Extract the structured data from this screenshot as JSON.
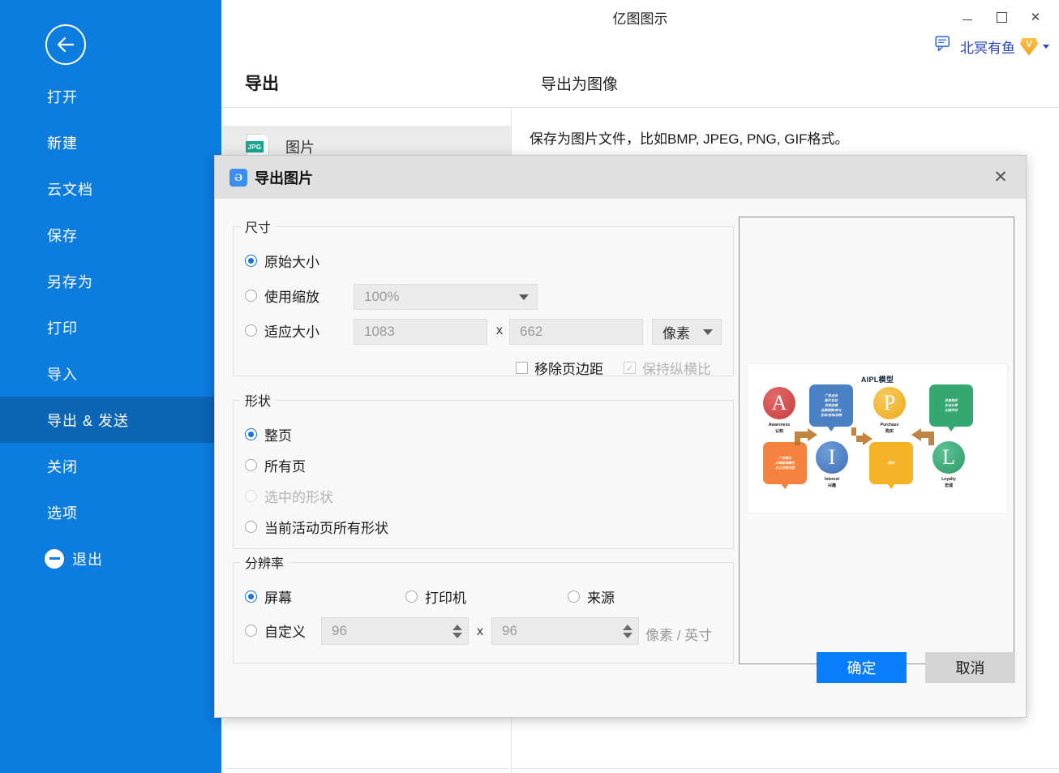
{
  "app": {
    "title": "亿图图示",
    "window_controls": {
      "minimize": "–",
      "maximize": "□",
      "close": "×"
    },
    "account": {
      "name": "北冥有鱼",
      "badge": "V"
    }
  },
  "backstage": {
    "back_icon": "back-arrow-icon",
    "items": [
      {
        "label": "打开",
        "active": false
      },
      {
        "label": "新建",
        "active": false
      },
      {
        "label": "云文档",
        "active": false
      },
      {
        "label": "保存",
        "active": false
      },
      {
        "label": "另存为",
        "active": false
      },
      {
        "label": "打印",
        "active": false
      },
      {
        "label": "导入",
        "active": false
      },
      {
        "label": "导出 & 发送",
        "active": true
      },
      {
        "label": "关闭",
        "active": false
      },
      {
        "label": "选项",
        "active": false
      }
    ],
    "exit": {
      "label": "退出"
    }
  },
  "stage": {
    "heading": "导出",
    "subheading": "导出为图像",
    "file_item": {
      "icon_label": "JPG",
      "label": "图片"
    },
    "description": "保存为图片文件，比如BMP, JPEG, PNG, GIF格式。"
  },
  "dialog": {
    "logo_glyph": "Ə",
    "title": "导出图片",
    "close_label": "✕",
    "size": {
      "legend": "尺寸",
      "original": {
        "label": "原始大小",
        "selected": true
      },
      "scale": {
        "label": "使用缩放",
        "selected": false,
        "value": "100%"
      },
      "fit": {
        "label": "适应大小",
        "selected": false,
        "width": "1083",
        "height": "662",
        "separator": "x",
        "unit": "像素"
      },
      "remove_margin": {
        "label": "移除页边距",
        "checked": false,
        "disabled": false
      },
      "keep_ratio": {
        "label": "保持纵横比",
        "checked": true,
        "disabled": true,
        "tick": "✓"
      }
    },
    "shape": {
      "legend": "形状",
      "options": [
        {
          "label": "整页",
          "selected": true,
          "disabled": false
        },
        {
          "label": "所有页",
          "selected": false,
          "disabled": false
        },
        {
          "label": "选中的形状",
          "selected": false,
          "disabled": true
        },
        {
          "label": "当前活动页所有形状",
          "selected": false,
          "disabled": false
        }
      ]
    },
    "resolution": {
      "legend": "分辨率",
      "options": [
        {
          "label": "屏幕",
          "selected": true
        },
        {
          "label": "打印机",
          "selected": false
        },
        {
          "label": "来源",
          "selected": false
        }
      ],
      "custom": {
        "label": "自定义",
        "selected": false,
        "x": "96",
        "y": "96",
        "separator": "x",
        "unit": "像素 / 英寸"
      }
    },
    "buttons": {
      "ok": "确定",
      "cancel": "取消"
    },
    "preview": {
      "diagram_title": "AIPL模型",
      "nodes": [
        {
          "letter": "A",
          "en": "Awareness",
          "cn": "认知",
          "color": "#d94a4a"
        },
        {
          "letter": "I",
          "en": "Interest",
          "cn": "兴趣",
          "color": "#4a80c4"
        },
        {
          "letter": "P",
          "en": "Purchase",
          "cn": "购买",
          "color": "#f0b429"
        },
        {
          "letter": "L",
          "en": "Loyalty",
          "cn": "忠诚",
          "color": "#34a870"
        }
      ],
      "bubbles": [
        {
          "text": "广告点击\n影片互动\n浏览店铺\n品牌搜索/参与\n互动/咨询/加购",
          "color": "#4a80c4"
        },
        {
          "text": "广告曝光\n公域店铺曝光\n水乙浏览内容",
          "color": "#f5833f"
        },
        {
          "text": "购买",
          "color": "#f5b327"
        },
        {
          "text": "反复购买\n主动分享\n正面评论",
          "color": "#34a870"
        }
      ]
    }
  },
  "colors": {
    "sidebar": "#0c7cdf",
    "sidebar_active": "#0b64b4",
    "accent": "#097efa",
    "dialog_titlebar": "#e0e0e0",
    "dialog_body": "#f8f8f8"
  }
}
